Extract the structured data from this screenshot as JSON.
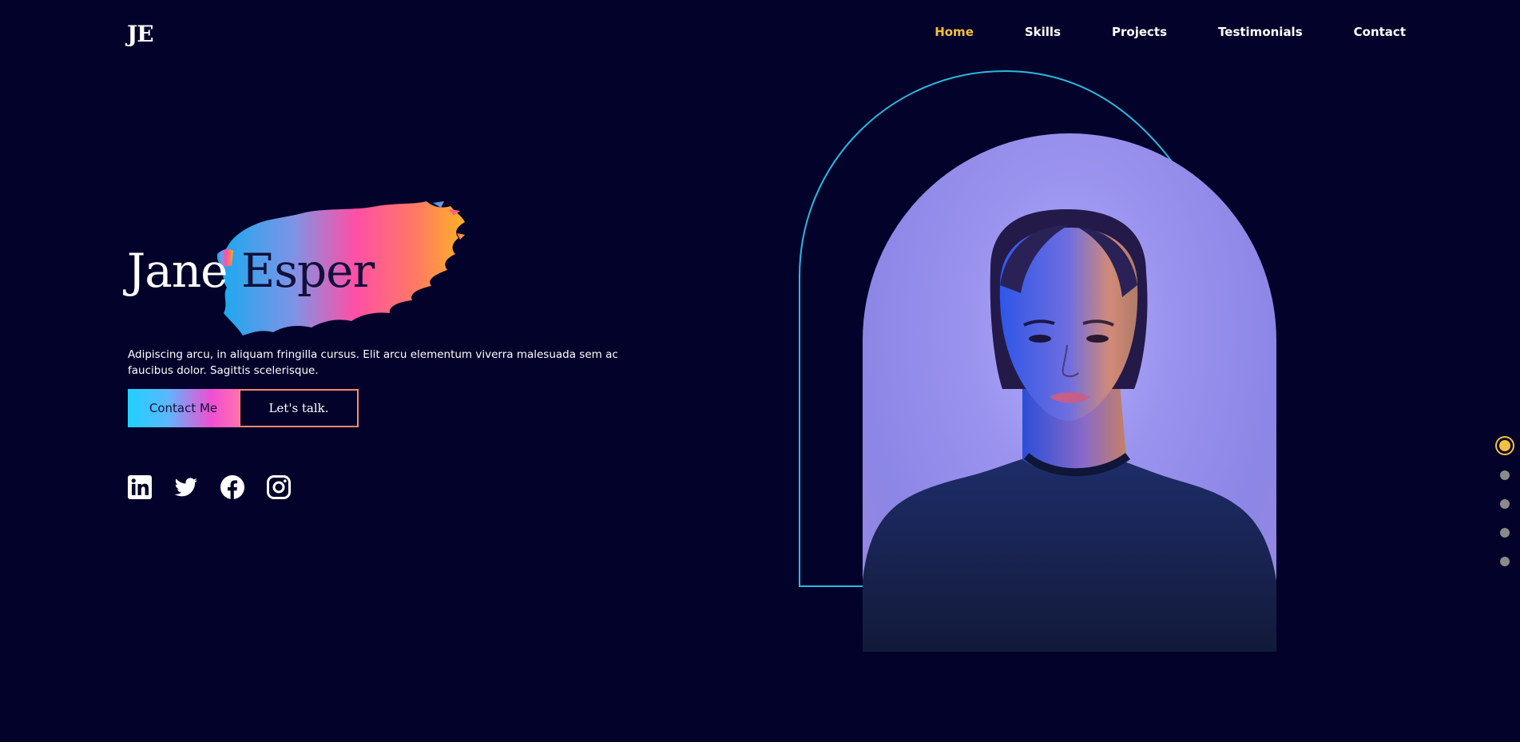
{
  "header": {
    "logo": "JE",
    "nav": [
      {
        "label": "Home",
        "active": true
      },
      {
        "label": "Skills",
        "active": false
      },
      {
        "label": "Projects",
        "active": false
      },
      {
        "label": "Testimonials",
        "active": false
      },
      {
        "label": "Contact",
        "active": false
      }
    ]
  },
  "hero": {
    "first_name": "Jane",
    "last_name": "Esper",
    "tagline": "Adipiscing arcu, in aliquam fringilla cursus. Elit arcu elementum viverra malesuada sem ac faucibus dolor. Sagittis scelerisque.",
    "contact_button": "Contact Me",
    "talk_button": "Let's talk."
  },
  "socials": [
    {
      "icon": "linkedin-icon"
    },
    {
      "icon": "twitter-icon"
    },
    {
      "icon": "facebook-icon"
    },
    {
      "icon": "instagram-icon"
    }
  ],
  "section_dots": {
    "count": 5,
    "active_index": 0
  },
  "colors": {
    "background": "#03022a",
    "accent_yellow": "#f4c13d",
    "arch_outline": "#2bb8e0",
    "button_gradient_start": "#1fd0ff",
    "button_gradient_end": "#ff6fb0",
    "button_border": "#ff8a6a"
  }
}
